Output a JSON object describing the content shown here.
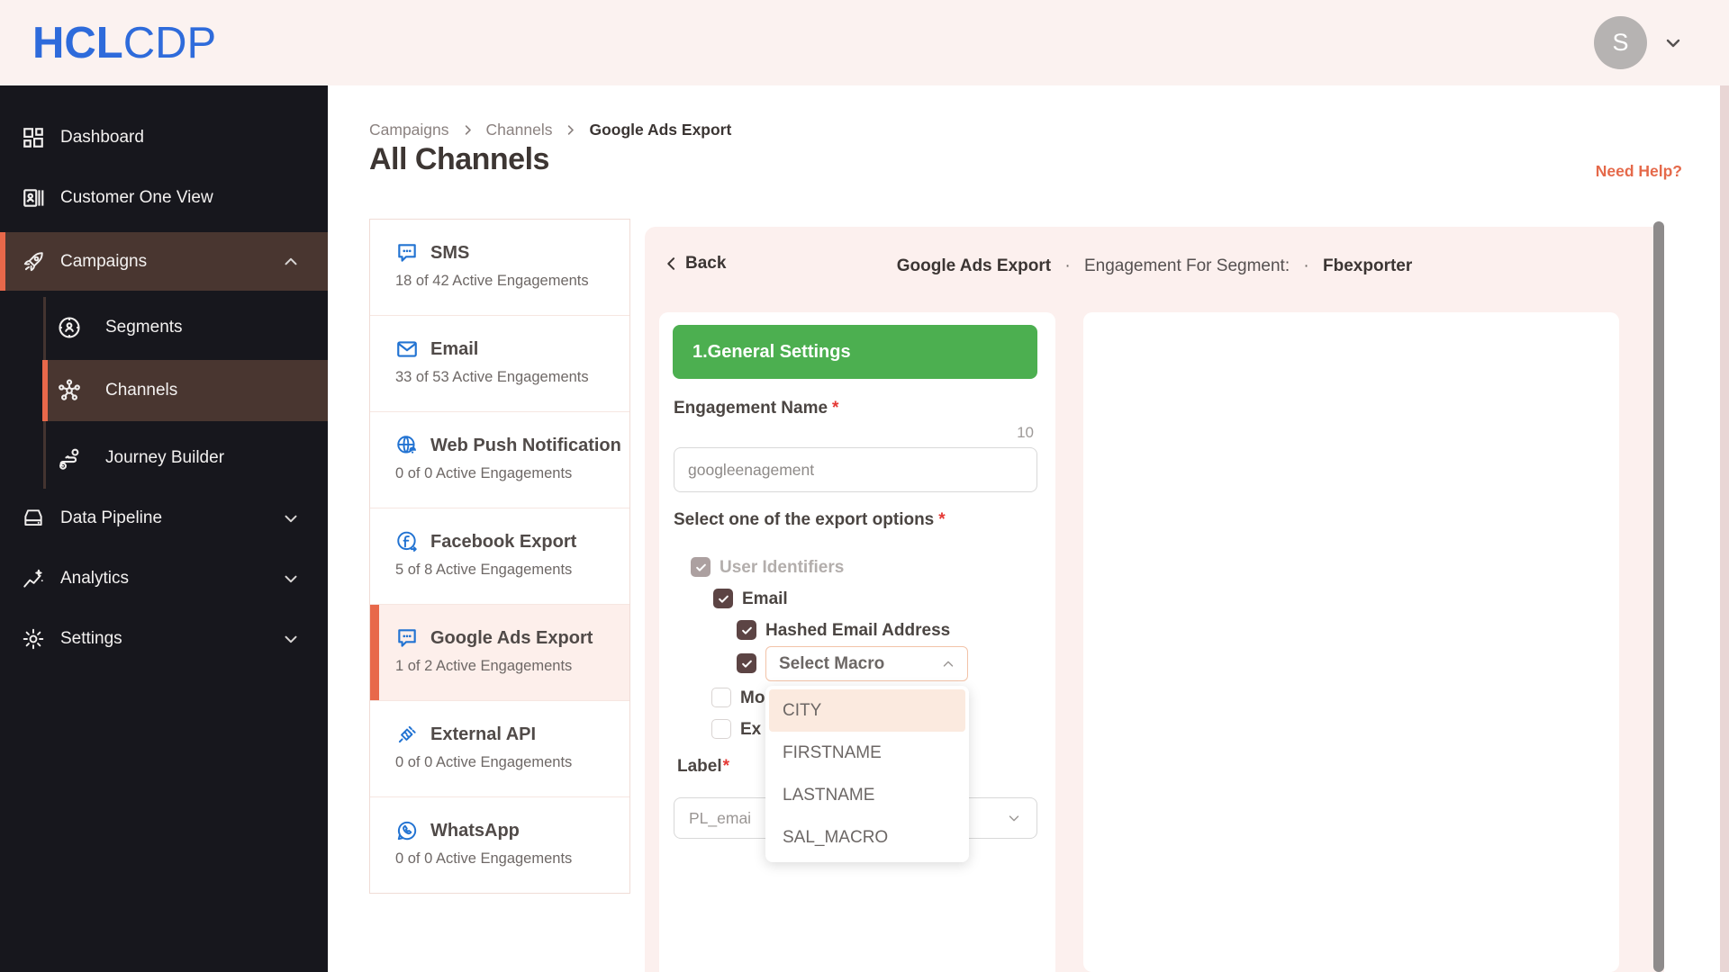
{
  "header": {
    "logo_bold": "HCL",
    "logo_light": "CDP",
    "avatar_initial": "S"
  },
  "nav": {
    "items": [
      {
        "label": "Dashboard"
      },
      {
        "label": "Customer One View"
      },
      {
        "label": "Campaigns"
      },
      {
        "label": "Segments"
      },
      {
        "label": "Channels"
      },
      {
        "label": "Journey Builder"
      },
      {
        "label": "Data Pipeline"
      },
      {
        "label": "Analytics"
      },
      {
        "label": "Settings"
      }
    ]
  },
  "breadcrumb": {
    "item1": "Campaigns",
    "item2": "Channels",
    "item3": "Google Ads Export"
  },
  "page": {
    "title": "All Channels",
    "help_link": "Need Help?"
  },
  "channels": [
    {
      "name": "SMS",
      "stats": "18 of 42 Active Engagements"
    },
    {
      "name": "Email",
      "stats": "33 of 53 Active Engagements"
    },
    {
      "name": "Web Push Notification",
      "stats": "0 of 0 Active Engagements"
    },
    {
      "name": "Facebook Export",
      "stats": "5 of 8 Active Engagements"
    },
    {
      "name": "Google Ads Export",
      "stats": "1 of 2 Active Engagements"
    },
    {
      "name": "External API",
      "stats": "0 of 0 Active Engagements"
    },
    {
      "name": "WhatsApp",
      "stats": "0 of 0 Active Engagements"
    }
  ],
  "detail": {
    "back": "Back",
    "title": "Google Ads Export",
    "dot": "·",
    "subtitle": "Engagement For Segment:",
    "segment": "Fbexporter",
    "section": "1.General Settings",
    "name_label": "Engagement Name",
    "required": "*",
    "char_count": "10",
    "name_value": "googleenagement",
    "export_label": "Select one of the export options",
    "opt_user_identifiers": "User Identifiers",
    "opt_email": "Email",
    "opt_hashed": "Hashed Email Address",
    "macro_placeholder": "Select Macro",
    "opt_clipped_1": "Mo",
    "opt_clipped_2": "Ex",
    "label_field": "Label",
    "label_value": "PL_emai",
    "macro_options": [
      {
        "label": "CITY"
      },
      {
        "label": "FIRSTNAME"
      },
      {
        "label": "LASTNAME"
      },
      {
        "label": "SAL_MACRO"
      }
    ],
    "highlighted_option": "CITY"
  },
  "colors": {
    "accent": "#e8684a",
    "section_green": "#4caf50",
    "brand_blue": "#2e6bdb",
    "icon_blue": "#2273d2",
    "checkbox": "#5c4444"
  }
}
